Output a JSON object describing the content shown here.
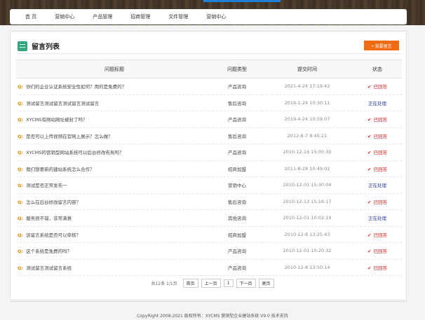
{
  "nav": {
    "items": [
      "首 页",
      "营销中心",
      "产品管理",
      "招商管理",
      "文件管理",
      "营销中心"
    ]
  },
  "panel": {
    "title": "留言列表",
    "post_button": "+ 我要留言"
  },
  "table": {
    "headers": [
      "问题标题",
      "问题类型",
      "提交时间",
      "状态"
    ],
    "rows": [
      {
        "title": "你们的企业认证系统安全性如何？用的是免费的？",
        "type": "产品咨询",
        "time": "2021-4-24 17:19:42",
        "status": "已回答",
        "done": true
      },
      {
        "title": "测试留言测试留言测试留言测试留言",
        "type": "售后咨询",
        "time": "2019-1-24 10:30:11",
        "status": "正在处理",
        "done": false
      },
      {
        "title": "XYCMS有网站网址被封了吗？",
        "type": "产品咨询",
        "time": "2019-4-24 10:59:07",
        "status": "已回答",
        "done": true
      },
      {
        "title": "是否可以上传视频在官网上展示？怎么做？",
        "type": "售后咨询",
        "time": "2012-6-7 8:45:21",
        "status": "已回答",
        "done": true
      },
      {
        "title": "XYCMS的营销型网站系统可以后台修改布局吗？",
        "type": "产品咨询",
        "time": "2010-12-16 15:00:30",
        "status": "已回答",
        "done": true
      },
      {
        "title": "我们想要新的建站系统怎么合作？",
        "type": "招商加盟",
        "time": "2011-8-28 10:49:02",
        "status": "已回答",
        "done": true
      },
      {
        "title": "测试是否正常发布一",
        "type": "营销中心",
        "time": "2010-12-01 15:30:04",
        "status": "正在处理",
        "done": false
      },
      {
        "title": "怎么在后台修改留言内容？",
        "type": "售后咨询",
        "time": "2010-12-13 15:16:17",
        "status": "已回答",
        "done": true
      },
      {
        "title": "服务很不错，非常满意",
        "type": "其他咨询",
        "time": "2010-12-01 10:02:19",
        "status": "正在处理",
        "done": false
      },
      {
        "title": "该留言系统是否可以审核？",
        "type": "招商加盟",
        "time": "2010-12-8 13:25:43",
        "status": "已回答",
        "done": true
      },
      {
        "title": "这个系统是免费的吗？",
        "type": "产品咨询",
        "time": "2010-12-01 10:20:32",
        "status": "已回答",
        "done": true
      },
      {
        "title": "测试留言测试留言系统",
        "type": "产品咨询",
        "time": "2010-12-8 13:50:14",
        "status": "已回答",
        "done": true
      }
    ]
  },
  "pager": {
    "info": "共12条 1/1页",
    "first": "首页",
    "prev": "上一页",
    "current": "1",
    "next": "下一页",
    "last": "尾页"
  },
  "footer": {
    "text": "CopyRight 2008-2021 版权所有：XYCMS 营销型企业建站系统 V9.0  技术支持"
  },
  "colors": {
    "accent": "#f26a12",
    "done": "#d91d1d",
    "pending": "#2b3fa8",
    "question_mark": "#e98b00"
  }
}
